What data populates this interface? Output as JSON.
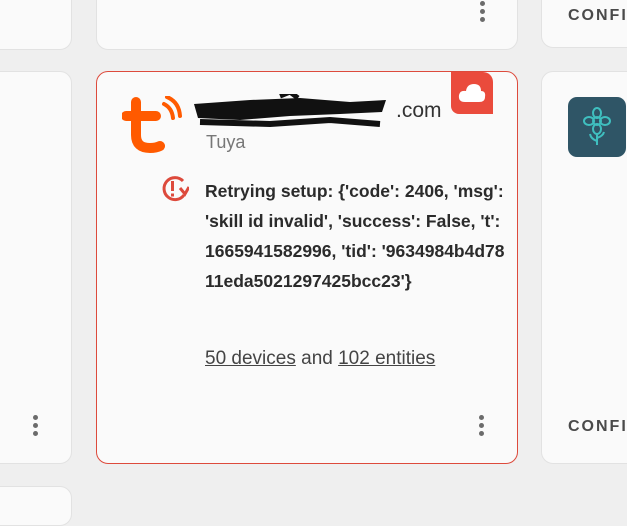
{
  "main_card": {
    "account": ".com",
    "integration": "Tuya",
    "error_text": "Retrying setup: {'code': 2406, 'msg': 'skill id invalid', 'success': False, 't': 1665941582996, 'tid': '9634984b4d7811eda5021297425bcc23'}",
    "devices_link": "50 devices",
    "and_text": "and",
    "entities_link": "102 entities"
  },
  "right_cards": {
    "configure_top": "CONFI",
    "configure_bottom": "CONFI"
  },
  "colors": {
    "error": "#dd4a3c",
    "tuya_orange": "#ff5a00",
    "cloud_badge": "#ea4b3c"
  },
  "icons": [
    "tuya-logo-icon",
    "cloud-icon",
    "setup-retry-icon",
    "more-vert-icon",
    "flower-icon"
  ]
}
